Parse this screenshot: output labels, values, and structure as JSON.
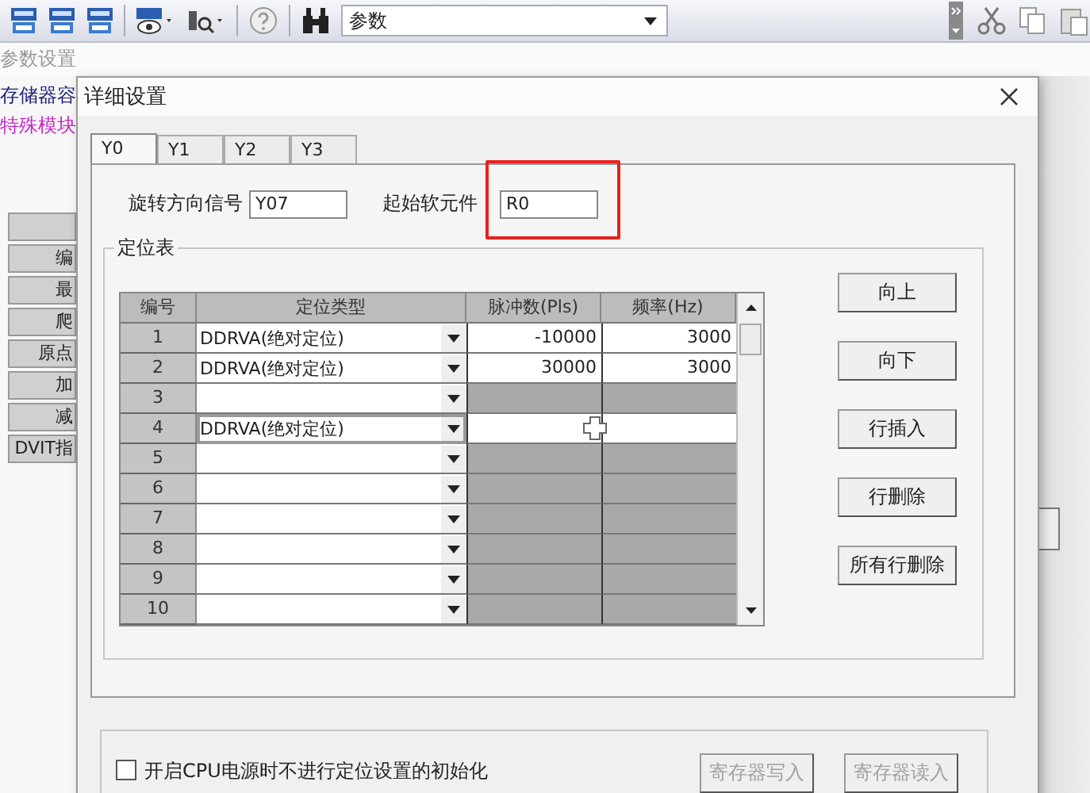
{
  "toolbar": {
    "combo": {
      "value": "参数"
    }
  },
  "background": {
    "title": "参数设置",
    "labels": [
      {
        "text": "存储器容",
        "color": "#1c1c7a"
      },
      {
        "text": "特殊模块",
        "color": "#cc22cc"
      }
    ],
    "side_cells": [
      "编",
      "最",
      "爬",
      "原点",
      "加",
      "减",
      "DVIT指"
    ]
  },
  "dialog": {
    "title": "详细设置",
    "tabs": [
      {
        "label": "Y0",
        "selected": true
      },
      {
        "label": "Y1",
        "selected": false
      },
      {
        "label": "Y2",
        "selected": false
      },
      {
        "label": "Y3",
        "selected": false
      }
    ],
    "rotation_signal": {
      "label": "旋转方向信号",
      "value": "Y07"
    },
    "start_device": {
      "label": "起始软元件",
      "value": "R0",
      "highlighted": true
    },
    "table": {
      "title": "定位表",
      "columns": [
        "编号",
        "定位类型",
        "脉冲数(Pls)",
        "频率(Hz)"
      ],
      "rows": [
        {
          "no": "1",
          "type": "DDRVA(绝对定位)",
          "pulses": "-10000",
          "frequency": "3000",
          "editable": true,
          "selected": false
        },
        {
          "no": "2",
          "type": "DDRVA(绝对定位)",
          "pulses": "30000",
          "frequency": "3000",
          "editable": true,
          "selected": false
        },
        {
          "no": "3",
          "editable": false,
          "selected": false
        },
        {
          "no": "4",
          "type": "DDRVA(绝对定位)",
          "editable": true,
          "selected": true
        },
        {
          "no": "5",
          "editable": false,
          "selected": false
        },
        {
          "no": "6",
          "editable": false,
          "selected": false
        },
        {
          "no": "7",
          "editable": false,
          "selected": false
        },
        {
          "no": "8",
          "editable": false,
          "selected": false
        },
        {
          "no": "9",
          "editable": false,
          "selected": false
        },
        {
          "no": "10",
          "editable": false,
          "selected": false
        }
      ]
    },
    "buttons": [
      "向上",
      "向下",
      "行插入",
      "行删除",
      "所有行删除"
    ],
    "init_checkbox": {
      "label": "开启CPU电源时不进行定位设置的初始化",
      "checked": false
    },
    "register_buttons": [
      {
        "label": "寄存器写入",
        "disabled": true
      },
      {
        "label": "寄存器读入",
        "disabled": true
      }
    ]
  }
}
